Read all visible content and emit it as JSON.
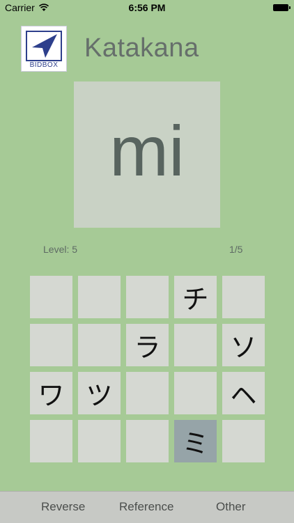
{
  "status_bar": {
    "carrier": "Carrier",
    "time": "6:56 PM"
  },
  "header": {
    "logo_text": "BIDBOX",
    "title": "Katakana"
  },
  "card": {
    "romaji": "mi"
  },
  "info": {
    "level": "Level: 5",
    "progress": "1/5"
  },
  "grid": {
    "rows": [
      [
        "",
        "",
        "",
        "チ",
        ""
      ],
      [
        "",
        "",
        "ラ",
        "",
        "ソ"
      ],
      [
        "ワ",
        "ツ",
        "",
        "",
        "ヘ"
      ],
      [
        "",
        "",
        "",
        "ミ",
        ""
      ]
    ],
    "selected_cell": "ミ"
  },
  "tabbar": {
    "reverse": "Reverse",
    "reference": "Reference",
    "other": "Other"
  },
  "colors": {
    "background": "#a6ca96",
    "card": "#c9d2c5",
    "cell": "#d5d8d2",
    "selected_cell": "#96a4a8",
    "logo_blue": "#2d3f8c"
  }
}
